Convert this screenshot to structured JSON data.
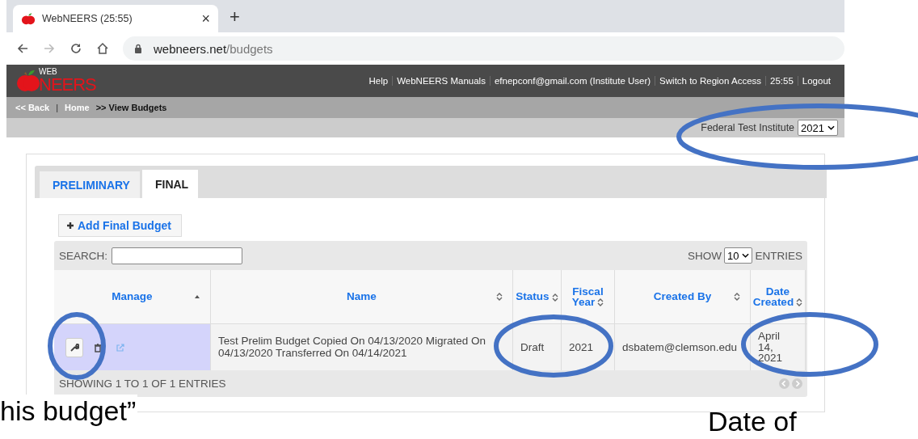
{
  "browser": {
    "tab_title": "WebNEERS (25:55)",
    "close": "×",
    "new_tab": "+",
    "url_host": "webneers.net",
    "url_path": "/budgets"
  },
  "header": {
    "logo_small": "WEB",
    "logo_big": "NEERS",
    "links": [
      "Help",
      "WebNEERS Manuals",
      "efnepconf@gmail.com (Institute User)",
      "Switch to Region Access",
      "25:55",
      "Logout"
    ]
  },
  "breadcrumb": {
    "back": "<< Back",
    "separator": "|",
    "home": "Home",
    "current": ">> View Budgets"
  },
  "institute": {
    "name": "Federal Test Institute",
    "year": "2021"
  },
  "tabs": [
    {
      "label": "PRELIMINARY",
      "selected": false
    },
    {
      "label": "FINAL",
      "selected": true
    }
  ],
  "add_button": "Add Final Budget",
  "table": {
    "search_label": "SEARCH:",
    "show_label": "SHOW",
    "page_size": "10",
    "entries_label": "ENTRIES",
    "columns": [
      {
        "label": "Manage",
        "sorted": true
      },
      {
        "label": "Name",
        "sorted": false
      },
      {
        "label": "Status",
        "sorted": false
      },
      {
        "label": "Fiscal Year",
        "sorted": false
      },
      {
        "label": "Created By",
        "sorted": false
      },
      {
        "label": "Date Created",
        "sorted": false
      }
    ],
    "rows": [
      {
        "name": "Test Prelim Budget Copied On 04/13/2020 Migrated On 04/13/2020 Transferred On 04/14/2021",
        "status": "Draft",
        "fiscal_year": "2021",
        "created_by": "dsbatem@clemson.edu",
        "date_created": "April 14, 2021"
      }
    ],
    "info": "SHOWING 1 TO 1 OF 1 ENTRIES"
  },
  "captions": [
    "his budget”",
    "Date of"
  ]
}
